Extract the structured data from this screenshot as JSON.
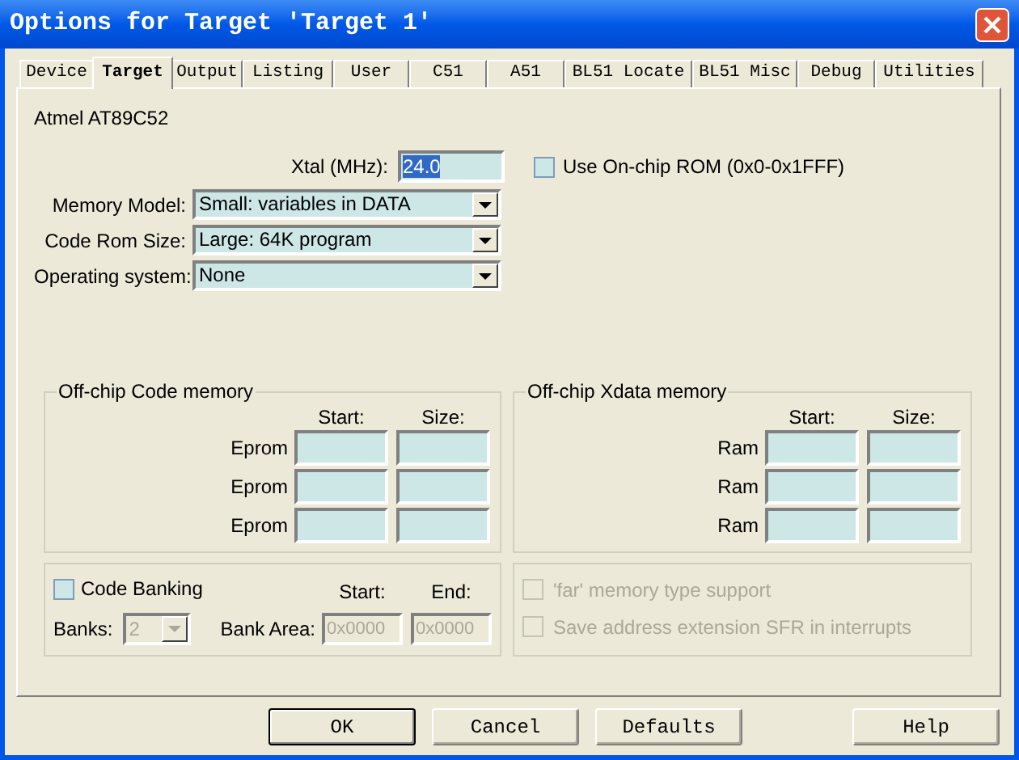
{
  "window": {
    "title": "Options for Target 'Target 1'"
  },
  "tabs": [
    {
      "label": "Device",
      "selected": false
    },
    {
      "label": "Target",
      "selected": true
    },
    {
      "label": "Output",
      "selected": false
    },
    {
      "label": "Listing",
      "selected": false
    },
    {
      "label": "User",
      "selected": false
    },
    {
      "label": "C51",
      "selected": false
    },
    {
      "label": "A51",
      "selected": false
    },
    {
      "label": "BL51 Locate",
      "selected": false
    },
    {
      "label": "BL51 Misc",
      "selected": false
    },
    {
      "label": "Debug",
      "selected": false
    },
    {
      "label": "Utilities",
      "selected": false
    }
  ],
  "device": "Atmel AT89C52",
  "xtal": {
    "label": "Xtal (MHz):",
    "value": "24.0",
    "value_selected": true
  },
  "on_chip_rom": {
    "label": "Use On-chip ROM (0x0-0x1FFF)",
    "checked": false
  },
  "dropdowns": [
    {
      "label": "Memory Model:",
      "value": "Small: variables in DATA"
    },
    {
      "label": "Code Rom Size:",
      "value": "Large: 64K program"
    },
    {
      "label": "Operating system:",
      "value": "None"
    }
  ],
  "memory_groups": [
    {
      "title": "Off-chip Code memory",
      "start_header": "Start:",
      "size_header": "Size:",
      "rows": [
        {
          "label": "Eprom"
        },
        {
          "label": "Eprom"
        },
        {
          "label": "Eprom"
        }
      ]
    },
    {
      "title": "Off-chip Xdata memory",
      "start_header": "Start:",
      "size_header": "Size:",
      "rows": [
        {
          "label": "Ram"
        },
        {
          "label": "Ram"
        },
        {
          "label": "Ram"
        }
      ]
    }
  ],
  "code_banking": {
    "label": "Code Banking",
    "checked": false,
    "start_header": "Start:",
    "end_header": "End:",
    "banks_label": "Banks:",
    "banks_value": "2",
    "banks_disabled": true,
    "bank_area_label": "Bank Area:",
    "start_value": "0x0000",
    "end_value": "0x0000",
    "area_disabled": true
  },
  "options": [
    {
      "label": "'far' memory type support",
      "checked": false,
      "disabled": true
    },
    {
      "label": "Save address extension SFR in interrupts",
      "checked": false,
      "disabled": true
    }
  ],
  "buttons": [
    {
      "label": "OK",
      "default": true
    },
    {
      "label": "Cancel",
      "default": false
    },
    {
      "label": "Defaults",
      "default": false
    },
    {
      "label": "Help",
      "default": false
    }
  ]
}
